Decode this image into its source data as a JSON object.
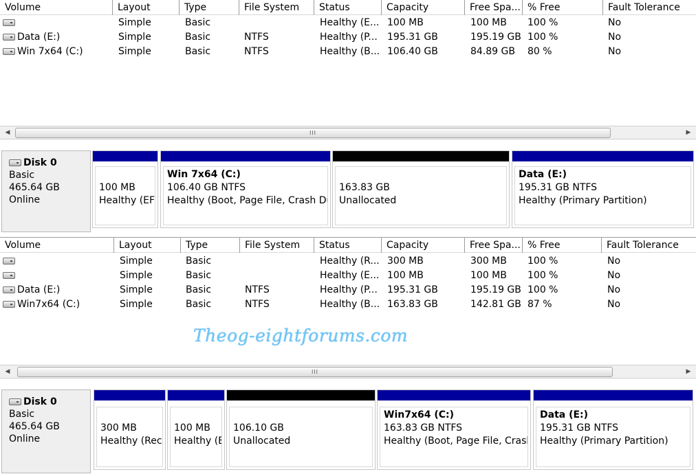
{
  "columns": [
    "Volume",
    "Layout",
    "Type",
    "File System",
    "Status",
    "Capacity",
    "Free Spa...",
    "% Free",
    "Fault Tolerance"
  ],
  "top_volumes": [
    {
      "volume": "",
      "layout": "Simple",
      "type": "Basic",
      "fs": "",
      "status": "Healthy (E...",
      "capacity": "100 MB",
      "free": "100 MB",
      "pct": "100 %",
      "fault": "No"
    },
    {
      "volume": "Data (E:)",
      "layout": "Simple",
      "type": "Basic",
      "fs": "NTFS",
      "status": "Healthy (P...",
      "capacity": "195.31 GB",
      "free": "195.19 GB",
      "pct": "100 %",
      "fault": "No"
    },
    {
      "volume": "Win 7x64 (C:)",
      "layout": "Simple",
      "type": "Basic",
      "fs": "NTFS",
      "status": "Healthy (B...",
      "capacity": "106.40 GB",
      "free": "84.89 GB",
      "pct": "80 %",
      "fault": "No"
    }
  ],
  "top_disk": {
    "name": "Disk 0",
    "type": "Basic",
    "size": "465.64 GB",
    "state": "Online",
    "partitions": [
      {
        "title": "",
        "size": "100 MB",
        "status": "Healthy (EFI",
        "bar": "#00009c"
      },
      {
        "title": "Win 7x64  (C:)",
        "size": "106.40 GB NTFS",
        "status": "Healthy (Boot, Page File, Crash Du",
        "bar": "#00009c"
      },
      {
        "title": "",
        "size": "163.83 GB",
        "status": "Unallocated",
        "bar": "#000000"
      },
      {
        "title": "Data  (E:)",
        "size": "195.31 GB NTFS",
        "status": "Healthy (Primary Partition)",
        "bar": "#00009c"
      }
    ]
  },
  "bottom_volumes": [
    {
      "volume": "",
      "layout": "Simple",
      "type": "Basic",
      "fs": "",
      "status": "Healthy (R...",
      "capacity": "300 MB",
      "free": "300 MB",
      "pct": "100 %",
      "fault": "No"
    },
    {
      "volume": "",
      "layout": "Simple",
      "type": "Basic",
      "fs": "",
      "status": "Healthy (E...",
      "capacity": "100 MB",
      "free": "100 MB",
      "pct": "100 %",
      "fault": "No"
    },
    {
      "volume": "Data (E:)",
      "layout": "Simple",
      "type": "Basic",
      "fs": "NTFS",
      "status": "Healthy (P...",
      "capacity": "195.31 GB",
      "free": "195.19 GB",
      "pct": "100 %",
      "fault": "No"
    },
    {
      "volume": "Win7x64 (C:)",
      "layout": "Simple",
      "type": "Basic",
      "fs": "NTFS",
      "status": "Healthy (B...",
      "capacity": "163.83 GB",
      "free": "142.81 GB",
      "pct": "87 %",
      "fault": "No"
    }
  ],
  "bottom_disk": {
    "name": "Disk 0",
    "type": "Basic",
    "size": "465.64 GB",
    "state": "Online",
    "partitions": [
      {
        "title": "",
        "size": "300 MB",
        "status": "Healthy (Reco",
        "bar": "#00009c"
      },
      {
        "title": "",
        "size": "100 MB",
        "status": "Healthy (E",
        "bar": "#00009c"
      },
      {
        "title": "",
        "size": "106.10 GB",
        "status": "Unallocated",
        "bar": "#000000"
      },
      {
        "title": "Win7x64  (C:)",
        "size": "163.83 GB NTFS",
        "status": "Healthy (Boot, Page File, Crash",
        "bar": "#00009c"
      },
      {
        "title": "Data  (E:)",
        "size": "195.31 GB NTFS",
        "status": "Healthy (Primary Partition)",
        "bar": "#00009c"
      }
    ]
  },
  "scrollbar_grip": "III",
  "watermark": "Theog-eightforums.com",
  "icons": {
    "left": "scroll-left-icon",
    "right": "scroll-right-icon",
    "disk": "disk-drive-icon"
  }
}
